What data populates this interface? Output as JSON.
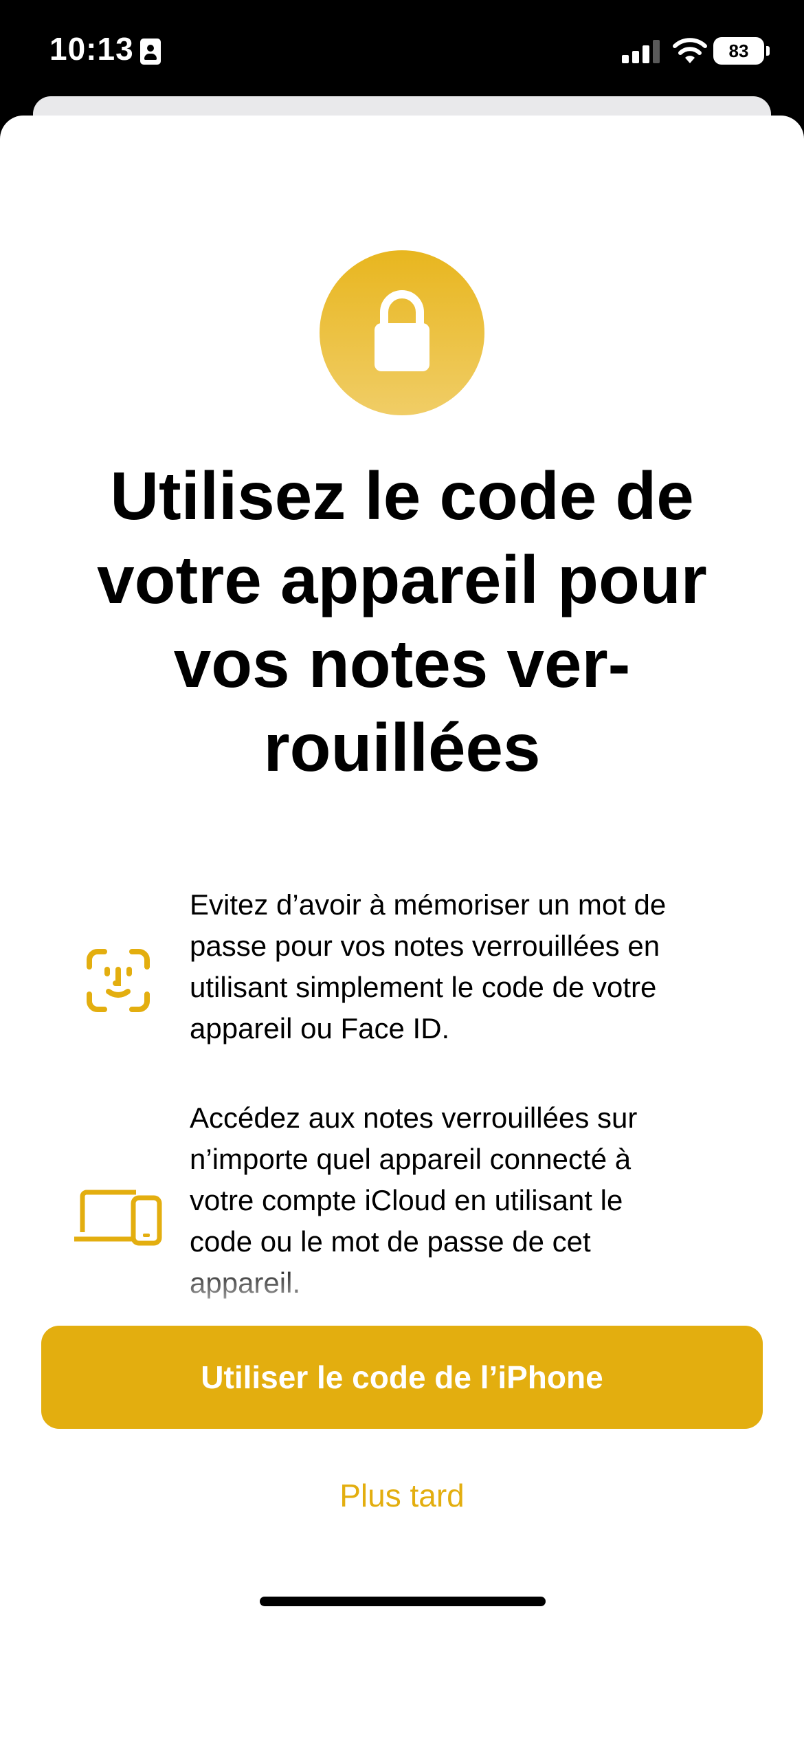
{
  "status_bar": {
    "time": "10:13",
    "battery_level": "83"
  },
  "colors": {
    "accent": "#E3AE0F",
    "icon_badge_top": "#E8B61F",
    "icon_badge_bottom": "#F0CD66"
  },
  "icons": {
    "header": "lock-icon",
    "feature_1": "face-id-icon",
    "feature_2": "laptop-and-phone-icon"
  },
  "onboarding": {
    "title": "Utilisez le code de\nvotre appareil pour\nvos notes ver-\nrouillées",
    "features": [
      {
        "text": "Évitez d’avoir à mémoriser un mot de\npasse pour vos notes verrouillées en\nutilisant simplement le code de votre\nappareil ou Face ID."
      },
      {
        "text": "Accédez aux notes verrouillées sur\nn’importe quel appareil connecté à\nvotre compte iCloud en utilisant le\ncode ou le mot de passe de cet\nappareil."
      }
    ]
  },
  "actions": {
    "primary_label": "Utiliser le code de l’iPhone",
    "secondary_label": "Plus tard"
  }
}
